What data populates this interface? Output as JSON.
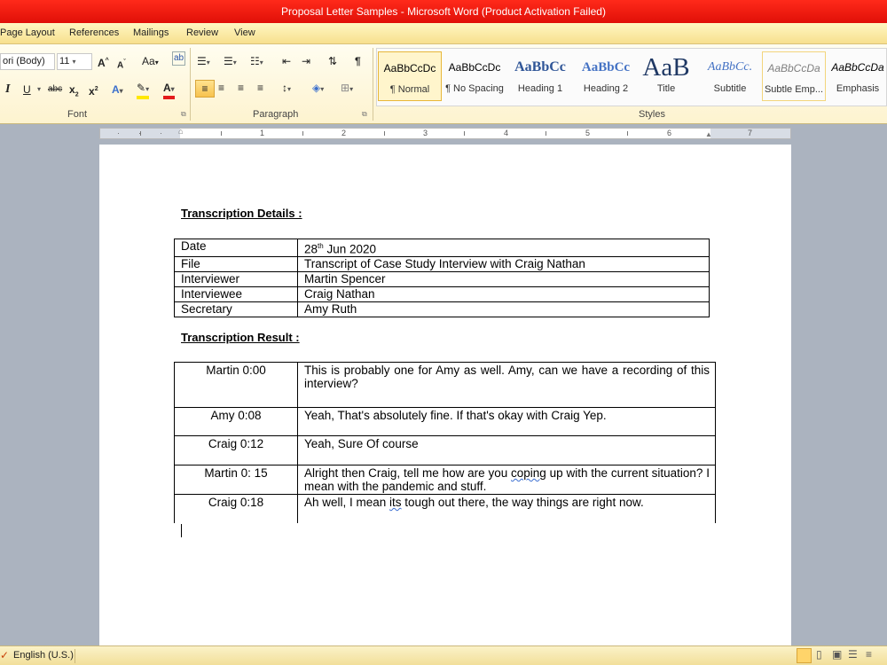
{
  "window": {
    "title": "Proposal Letter Samples - Microsoft Word (Product Activation Failed)"
  },
  "ribbon_tabs": [
    "Page Layout",
    "References",
    "Mailings",
    "Review",
    "View"
  ],
  "font_group": {
    "font_name": "ori (Body)",
    "font_size": "11",
    "change_case": "Aa",
    "label": "Font"
  },
  "paragraph_group": {
    "label": "Paragraph"
  },
  "styles_group": {
    "label": "Styles",
    "tiles": [
      {
        "sample": "AaBbCcDc",
        "name": "¶ Normal"
      },
      {
        "sample": "AaBbCcDc",
        "name": "¶ No Spacing"
      },
      {
        "sample": "AaBbCc",
        "name": "Heading 1"
      },
      {
        "sample": "AaBbCc",
        "name": "Heading 2"
      },
      {
        "sample": "AaB",
        "name": "Title"
      },
      {
        "sample": "AaBbCc.",
        "name": "Subtitle"
      },
      {
        "sample": "AaBbCcDa",
        "name": "Subtle Emp..."
      },
      {
        "sample": "AaBbCcDa",
        "name": "Emphasis"
      }
    ]
  },
  "ruler": {
    "numbers": [
      "1",
      "2",
      "3",
      "4",
      "5",
      "6",
      "7"
    ]
  },
  "document": {
    "heading_details": "Transcription Details :",
    "details": [
      {
        "label": "Date",
        "value_main": "28",
        "value_sup": "th",
        "value_rest": " Jun 2020"
      },
      {
        "label": "File",
        "value": "Transcript of Case Study Interview with Craig Nathan"
      },
      {
        "label": "Interviewer",
        "value": "Martin Spencer"
      },
      {
        "label": "Interviewee",
        "value": "Craig Nathan"
      },
      {
        "label": "Secretary",
        "value": "Amy Ruth"
      }
    ],
    "heading_result": "Transcription Result :",
    "result": [
      {
        "speaker": "Martin  0:00",
        "text": "This is probably one for Amy as well. Amy, can we have a recording of this interview?"
      },
      {
        "speaker": "Amy  0:08",
        "text": "Yeah, That's absolutely fine. If that's okay with Craig Yep."
      },
      {
        "speaker": "Craig  0:12",
        "text": "Yeah, Sure Of course"
      },
      {
        "speaker": "Martin 0: 15",
        "text_a": "Alright then Craig, tell me how are you ",
        "text_spell": "coping",
        "text_b": " up with the current situation? I mean with the pandemic and stuff."
      },
      {
        "speaker": "Craig 0:18",
        "text_a": "Ah well, I mean ",
        "text_spell": "its",
        "text_b": " tough out there, the way things are right now."
      }
    ]
  },
  "statusbar": {
    "language": "English (U.S.)"
  },
  "colors": {
    "titlebar": "#e8160e",
    "ribbon": "#fdf3cf",
    "workspace": "#abb3bf"
  }
}
